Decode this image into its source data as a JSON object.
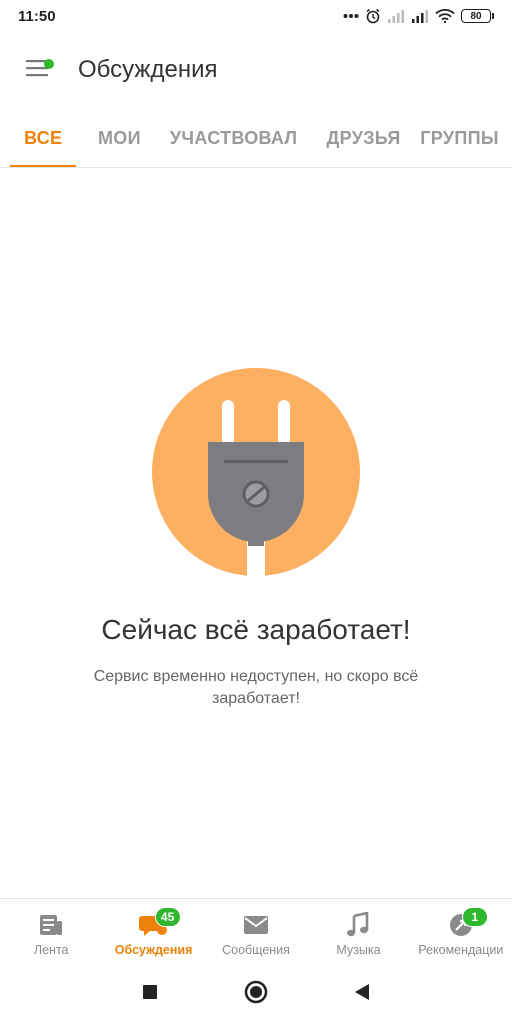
{
  "status_bar": {
    "time": "11:50",
    "battery": "80",
    "icons": [
      "dots-icon",
      "alarm-icon",
      "signal-icon",
      "signal-icon",
      "wifi-icon",
      "battery-icon"
    ]
  },
  "app_bar": {
    "title": "Обсуждения",
    "menu_icon": "hamburger-menu-icon",
    "notification_dot_color": "#2eb82e"
  },
  "tabs": [
    {
      "label": "ВСЕ",
      "active": true
    },
    {
      "label": "МОИ",
      "active": false
    },
    {
      "label": "УЧАСТВОВАЛ",
      "active": false
    },
    {
      "label": "ДРУЗЬЯ",
      "active": false
    },
    {
      "label": "ГРУППЫ",
      "active": false
    }
  ],
  "empty_state": {
    "illustration": "power-plug-icon",
    "title": "Сейчас всё заработает!",
    "text": "Сервис временно недоступен, но скоро всё заработает!"
  },
  "bottom_nav": [
    {
      "label": "Лента",
      "icon": "feed-icon",
      "active": false
    },
    {
      "label": "Обсуждения",
      "icon": "discussions-icon",
      "active": true,
      "badge": "45"
    },
    {
      "label": "Сообщения",
      "icon": "envelope-icon",
      "active": false
    },
    {
      "label": "Музыка",
      "icon": "music-note-icon",
      "active": false
    },
    {
      "label": "Рекомендации",
      "icon": "recommendations-icon",
      "active": false,
      "badge": "1"
    }
  ],
  "system_nav": [
    "recents-square-icon",
    "home-circle-icon",
    "back-triangle-icon"
  ],
  "colors": {
    "accent": "#ee8208",
    "badge": "#2eb82e",
    "illustration_circle": "#fdb062",
    "plug": "#7c7d80"
  }
}
